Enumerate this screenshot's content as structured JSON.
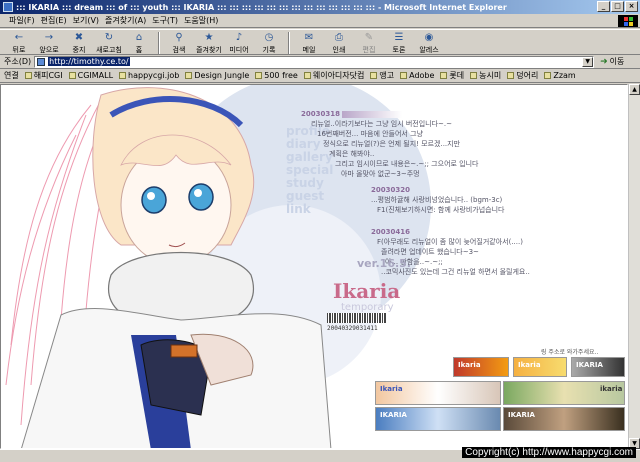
{
  "window": {
    "title": "::: IKARIA ::: dream ::: of ::: youth ::: IKARIA ::: ::: ::: ::: ::: ::: ::: ::: ::: ::: ::: ::: ::: - Microsoft Internet Explorer",
    "buttons": [
      "_",
      "□",
      "×"
    ]
  },
  "menu": [
    "파일(F)",
    "편집(E)",
    "보기(V)",
    "즐겨찾기(A)",
    "도구(T)",
    "도움말(H)"
  ],
  "toolbar": [
    {
      "label": "뒤로",
      "icon": "back-icon",
      "glyph": "←"
    },
    {
      "label": "앞으로",
      "icon": "forward-icon",
      "glyph": "→"
    },
    {
      "label": "중지",
      "icon": "stop-icon",
      "glyph": "✖"
    },
    {
      "label": "새로고침",
      "icon": "refresh-icon",
      "glyph": "↻"
    },
    {
      "label": "홈",
      "icon": "home-icon",
      "glyph": "⌂"
    },
    {
      "label": "검색",
      "icon": "search-icon",
      "glyph": "⚲"
    },
    {
      "label": "즐겨찾기",
      "icon": "favorites-icon",
      "glyph": "★"
    },
    {
      "label": "미디어",
      "icon": "media-icon",
      "glyph": "♪"
    },
    {
      "label": "기록",
      "icon": "history-icon",
      "glyph": "◷"
    },
    {
      "label": "메일",
      "icon": "mail-icon",
      "glyph": "✉"
    },
    {
      "label": "인쇄",
      "icon": "print-icon",
      "glyph": "⎙"
    },
    {
      "label": "편집",
      "icon": "edit-icon",
      "glyph": "✎"
    },
    {
      "label": "토론",
      "icon": "discuss-icon",
      "glyph": "☰"
    },
    {
      "label": "알레스",
      "icon": "alexa-icon",
      "glyph": "◉"
    }
  ],
  "address": {
    "label": "주소(D)",
    "url": "http://timothy.ce.to/",
    "go_label": "이동"
  },
  "links": {
    "label": "연결",
    "items": [
      "해피CGI",
      "CGIMALL",
      "happycgi.job",
      "Design Jungle",
      "500 free",
      "웨이아디자닷컴",
      "앵고",
      "Adobe",
      "롯데",
      "농시미",
      "덩어리",
      "Zzam"
    ]
  },
  "page": {
    "menu_items": [
      "profile",
      "diary",
      "gallery",
      "special",
      "study",
      "guest",
      "link"
    ],
    "posts": [
      {
        "date": "20030318",
        "lines": [
          "리뉴얼..이라기보다는 그냥 임시 버전입니다~.~",
          "16번째버전... 마음에 안들어서 그냥",
          "정식으로 리뉴얼(?)은 언제 될지! 모르겠...지만",
          "계획은 해봐야..",
          "그리고 임시이므로 내용은~.~;; 그으어로 입니다",
          "아마 올맞아 없군~3~주멍"
        ]
      },
      {
        "date": "20030320",
        "lines": [
          "...평범하귤해 사랑비넝었습니다.. (bgm-3c)",
          "F1(진체보기하시면: 함께 사랑비가넙습니다"
        ]
      },
      {
        "date": "20030416",
        "lines": [
          "F(아무래도 리뉴얼이 좀 많이 늦어질거같아서(....)",
          "졸려라면 업데이트 했습니다~3~",
          "아...  판함을..~.~;;",
          "..코믹사진도 있는데 그건 리뉴얼 하면서 올릴게요.."
        ]
      }
    ],
    "logo_title": "Ikaria",
    "logo_version": "ver.16.5.",
    "logo_sub": "temporary",
    "barcode_number": "20040329031411",
    "banners_caption": "링 주소로 와가주세요..",
    "banners": [
      "Ikaria",
      "Ikaria",
      "IKARIA",
      "Ikaria",
      "ikaria",
      "IKARIA",
      "IKARIA"
    ]
  },
  "watermark": "Copyright(c) http://www.happycgi.com"
}
